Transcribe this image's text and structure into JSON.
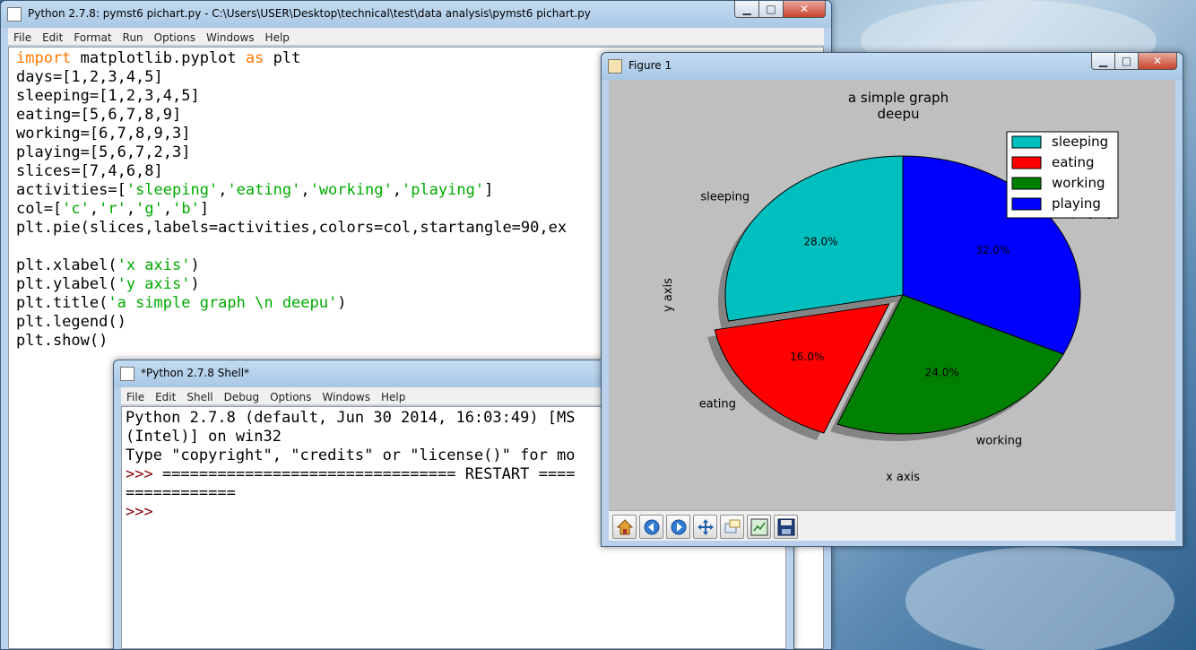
{
  "editor": {
    "title": "Python 2.7.8: pymst6 pichart.py - C:\\Users\\USER\\Desktop\\technical\\test\\data analysis\\pymst6 pichart.py",
    "menu": [
      "File",
      "Edit",
      "Format",
      "Run",
      "Options",
      "Windows",
      "Help"
    ],
    "code": [
      [
        {
          "t": "import",
          "c": "kw"
        },
        {
          "t": " matplotlib.pyplot "
        },
        {
          "t": "as",
          "c": "kw"
        },
        {
          "t": " plt"
        }
      ],
      [
        {
          "t": "days=[1,2,3,4,5]"
        }
      ],
      [
        {
          "t": "sleeping=[1,2,3,4,5]"
        }
      ],
      [
        {
          "t": "eating=[5,6,7,8,9]"
        }
      ],
      [
        {
          "t": "working=[6,7,8,9,3]"
        }
      ],
      [
        {
          "t": "playing=[5,6,7,2,3]"
        }
      ],
      [
        {
          "t": "slices=[7,4,6,8]"
        }
      ],
      [
        {
          "t": "activities=["
        },
        {
          "t": "'sleeping'",
          "c": "str"
        },
        {
          "t": ","
        },
        {
          "t": "'eating'",
          "c": "str"
        },
        {
          "t": ","
        },
        {
          "t": "'working'",
          "c": "str"
        },
        {
          "t": ","
        },
        {
          "t": "'playing'",
          "c": "str"
        },
        {
          "t": "]"
        }
      ],
      [
        {
          "t": "col=["
        },
        {
          "t": "'c'",
          "c": "str"
        },
        {
          "t": ","
        },
        {
          "t": "'r'",
          "c": "str"
        },
        {
          "t": ","
        },
        {
          "t": "'g'",
          "c": "str"
        },
        {
          "t": ","
        },
        {
          "t": "'b'",
          "c": "str"
        },
        {
          "t": "]"
        }
      ],
      [
        {
          "t": "plt.pie(slices,labels=activities,colors=col,startangle=90,ex"
        }
      ],
      [],
      [
        {
          "t": "plt.xlabel("
        },
        {
          "t": "'x axis'",
          "c": "str"
        },
        {
          "t": ")"
        }
      ],
      [
        {
          "t": "plt.ylabel("
        },
        {
          "t": "'y axis'",
          "c": "str"
        },
        {
          "t": ")"
        }
      ],
      [
        {
          "t": "plt.title("
        },
        {
          "t": "'a simple graph \\n deepu'",
          "c": "str"
        },
        {
          "t": ")"
        }
      ],
      [
        {
          "t": "plt.legend()"
        }
      ],
      [
        {
          "t": "plt.show()"
        }
      ]
    ]
  },
  "shell": {
    "title": "*Python 2.7.8 Shell*",
    "menu": [
      "File",
      "Edit",
      "Shell",
      "Debug",
      "Options",
      "Windows",
      "Help"
    ],
    "lines": [
      {
        "text": "Python 2.7.8 (default, Jun 30 2014, 16:03:49) [MS"
      },
      {
        "text": "(Intel)] on win32"
      },
      {
        "text": "Type \"copyright\", \"credits\" or \"license()\" for mo"
      },
      {
        "prompt": ">>> ",
        "text": "================================ RESTART ===="
      },
      {
        "text": "============"
      },
      {
        "prompt": ">>> ",
        "text": ""
      }
    ]
  },
  "figure": {
    "title": "Figure 1",
    "toolbar": [
      "home-icon",
      "back-icon",
      "forward-icon",
      "pan-icon",
      "zoom-icon",
      "subplots-icon",
      "save-icon"
    ]
  },
  "chart_data": {
    "type": "pie",
    "title": "a simple graph\ndeepu",
    "title_lines": [
      "a simple graph",
      "deepu"
    ],
    "xlabel": "x axis",
    "ylabel": "y axis",
    "categories": [
      "sleeping",
      "eating",
      "working",
      "playing"
    ],
    "values": [
      7,
      4,
      6,
      8
    ],
    "percent_labels": [
      "28.0%",
      "16.0%",
      "24.0%",
      "32.0%"
    ],
    "colors": [
      "#00bfbf",
      "#ff0000",
      "#008000",
      "#0000ff"
    ],
    "explode": [
      0,
      0.1,
      0,
      0
    ],
    "startangle": 90,
    "shadow": true,
    "legend_position": "top-right",
    "legend": [
      "sleeping",
      "eating",
      "working",
      "playing"
    ]
  }
}
